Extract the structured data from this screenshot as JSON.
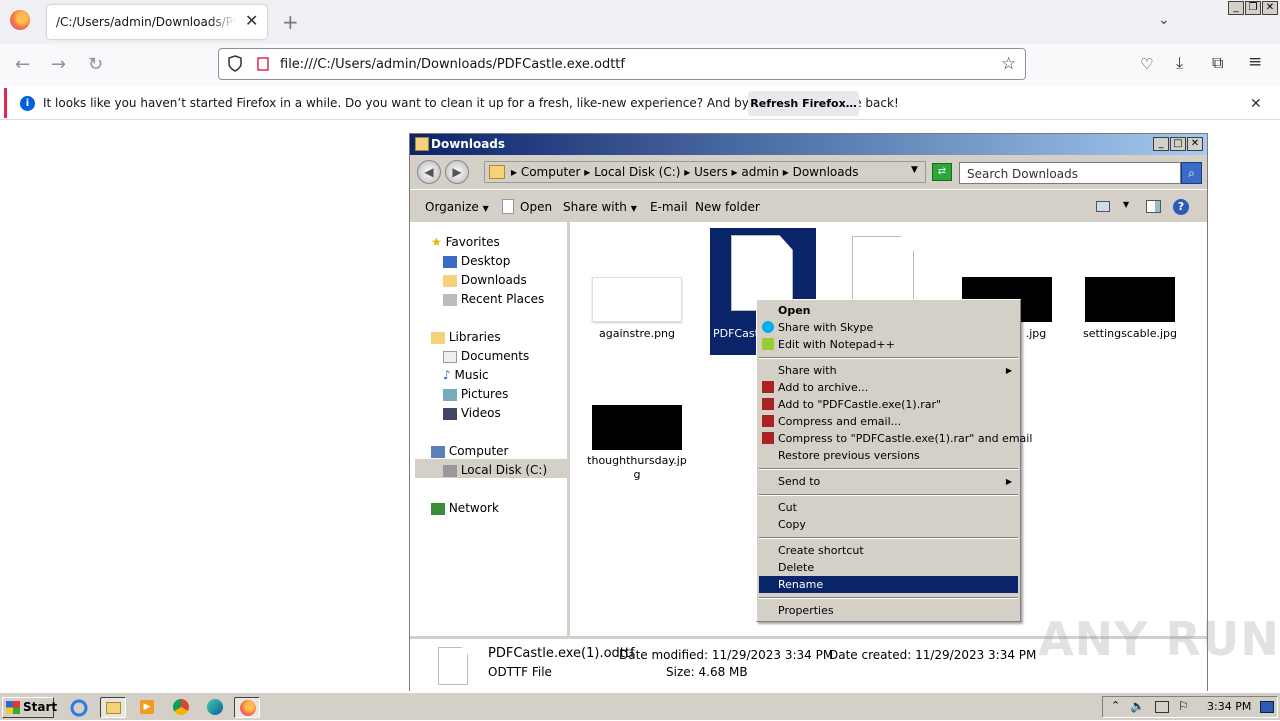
{
  "browser": {
    "tab_title": "/C:/Users/admin/Downloads/PDFCastle.exe.odttf",
    "url": "file:///C:/Users/admin/Downloads/PDFCastle.exe.odttf",
    "notification": {
      "text": "It looks like you haven’t started Firefox in a while. Do you want to clean it up for a fresh, like-new experience? And by the way, welcome back!",
      "button": "Refresh Firefox…"
    }
  },
  "explorer": {
    "title": "Downloads",
    "breadcrumb": [
      "Computer",
      "Local Disk (C:)",
      "Users",
      "admin",
      "Downloads"
    ],
    "breadcrumb_text": "▸  Computer  ▸  Local Disk (C:)  ▸  Users  ▸  admin  ▸  Downloads",
    "search_placeholder": "Search Downloads",
    "toolbar": {
      "organize": "Organize",
      "open": "Open",
      "share_with": "Share with",
      "email": "E-mail",
      "new_folder": "New folder"
    },
    "nav": {
      "favorites": "Favorites",
      "desktop": "Desktop",
      "downloads": "Downloads",
      "recent_places": "Recent Places",
      "libraries": "Libraries",
      "documents": "Documents",
      "music": "Music",
      "pictures": "Pictures",
      "videos": "Videos",
      "computer": "Computer",
      "local_disk": "Local Disk (C:)",
      "network": "Network"
    },
    "files": [
      {
        "name": "againstre.png"
      },
      {
        "name": "PDFCastle.exe(1).odttf",
        "visible_label": "PDFCast"
      },
      {
        "name": ""
      },
      {
        "name": ".jpg"
      },
      {
        "name": "settingscable.jpg"
      },
      {
        "name": "thoughthursday.jpg",
        "line1": "thoughthursday.jp",
        "line2": "g"
      }
    ],
    "details": {
      "name": "PDFCastle.exe(1).odttf",
      "type": "ODTTF File",
      "modified": "Date modified: 11/29/2023 3:34 PM",
      "created": "Date created: 11/29/2023 3:34 PM",
      "size": "Size: 4.68 MB"
    }
  },
  "context_menu": {
    "open": "Open",
    "share_skype": "Share with Skype",
    "edit_notepad": "Edit with Notepad++",
    "share_with": "Share with",
    "add_archive": "Add to archive...",
    "add_rar": "Add to \"PDFCastle.exe(1).rar\"",
    "compress_email": "Compress and email...",
    "compress_rar_email": "Compress to \"PDFCastle.exe(1).rar\" and email",
    "restore": "Restore previous versions",
    "send_to": "Send to",
    "cut": "Cut",
    "copy": "Copy",
    "create_shortcut": "Create shortcut",
    "delete": "Delete",
    "rename": "Rename",
    "properties": "Properties",
    "highlighted": "Rename"
  },
  "taskbar": {
    "start": "Start",
    "clock": "3:34 PM"
  },
  "watermark": "ANY RUN"
}
